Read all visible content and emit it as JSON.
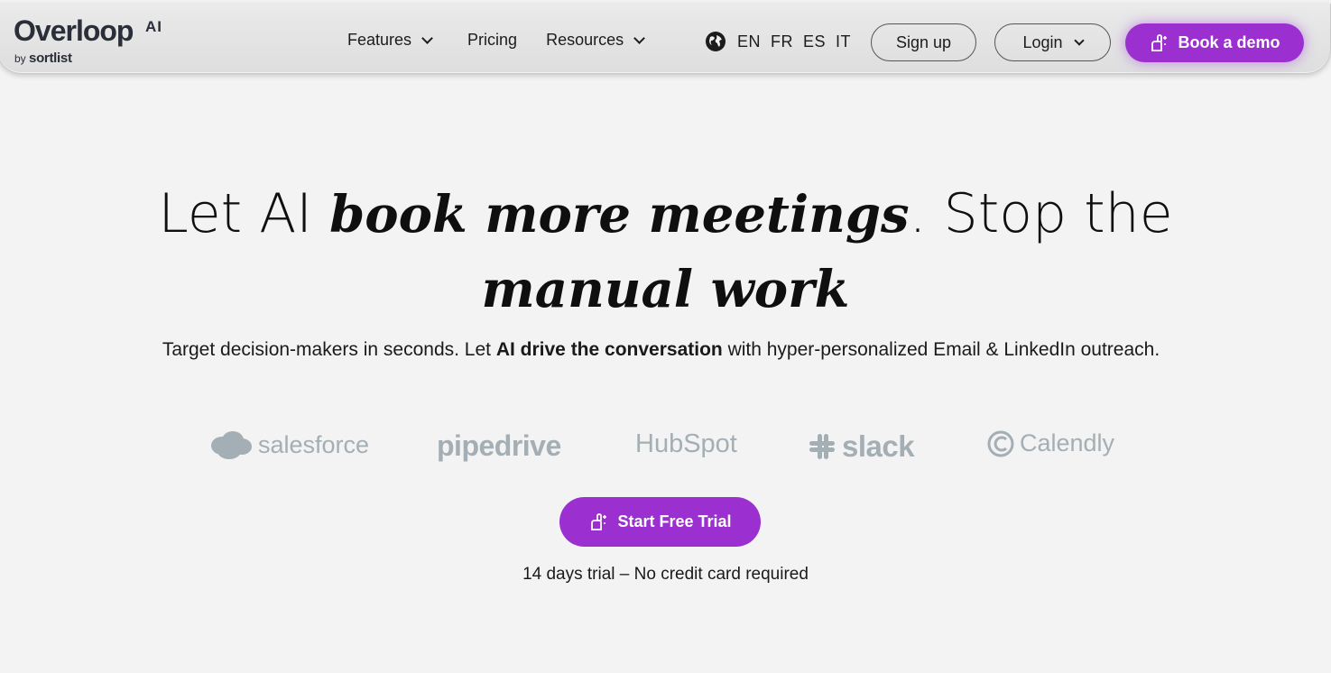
{
  "brand": {
    "name": "Overloop",
    "suffix": "AI",
    "by": "by",
    "parent": "sortlist"
  },
  "nav": {
    "features": "Features",
    "pricing": "Pricing",
    "resources": "Resources",
    "languages": [
      "EN",
      "FR",
      "ES",
      "IT"
    ],
    "signup": "Sign up",
    "login": "Login",
    "book_demo": "Book a demo"
  },
  "hero": {
    "title_part1": "Let AI ",
    "title_em1": "book more meetings",
    "title_part2": ". Stop the",
    "title_em2": "manual work",
    "subtitle_part1": "Target decision-makers in seconds. Let ",
    "subtitle_bold": "AI drive the conversation",
    "subtitle_part2": " with hyper-personalized Email & LinkedIn outreach."
  },
  "integrations": [
    "salesforce",
    "pipedrive",
    "HubSpot",
    "slack",
    "Calendly"
  ],
  "cta": {
    "label": "Start Free Trial",
    "note": "14 days trial – No credit card required"
  },
  "colors": {
    "accent": "#9b2fd0",
    "logo_gray": "#a4aeb5",
    "background": "#f3f3f3"
  }
}
